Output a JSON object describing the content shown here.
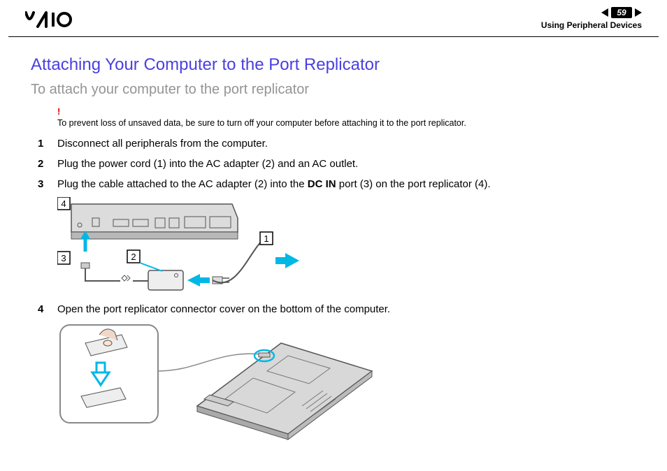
{
  "header": {
    "logo_text": "VAIO",
    "page_number": "59",
    "section": "Using Peripheral Devices"
  },
  "title": "Attaching Your Computer to the Port Replicator",
  "subtitle": "To attach your computer to the port replicator",
  "warning": {
    "mark": "!",
    "text": "To prevent loss of unsaved data, be sure to turn off your computer before attaching it to the port replicator."
  },
  "steps": [
    {
      "n": "1",
      "text": "Disconnect all peripherals from the computer."
    },
    {
      "n": "2",
      "text": "Plug the power cord (1) into the AC adapter (2) and an AC outlet."
    },
    {
      "n": "3",
      "text_pre": "Plug the cable attached to the AC adapter (2) into the ",
      "bold": "DC IN",
      "text_post": " port (3) on the port replicator (4)."
    },
    {
      "n": "4",
      "text": "Open the port replicator connector cover on the bottom of the computer."
    }
  ],
  "figure1": {
    "labels": {
      "l1": "1",
      "l2": "2",
      "l3": "3",
      "l4": "4"
    }
  }
}
